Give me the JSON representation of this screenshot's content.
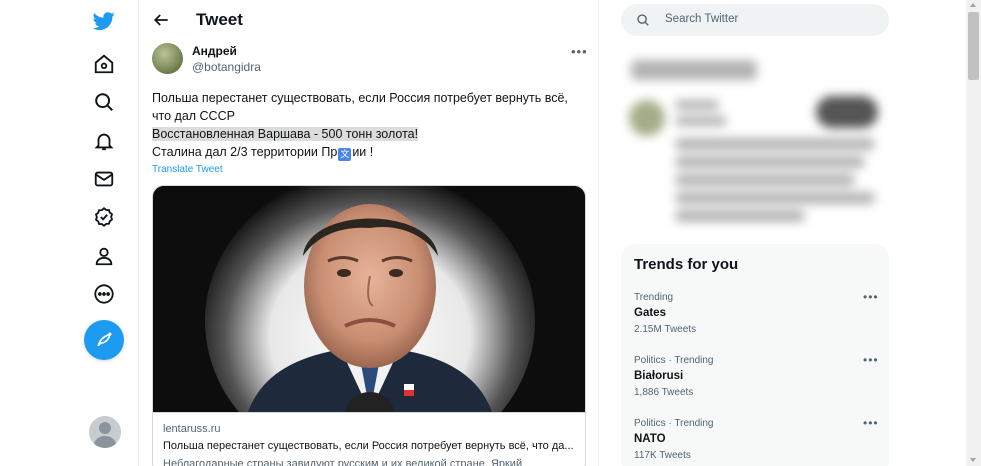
{
  "header": {
    "title": "Tweet"
  },
  "tweet": {
    "author_name": "Андрей",
    "author_handle": "@botangidra",
    "text_line1": "Польша перестанет существовать, если Россия потребует вернуть всё,",
    "text_line2": "что дал СССР",
    "text_line3": "Восстановленная Варшава - 500 тонн золота!",
    "text_line4_a": "Сталина дал 2/3 территории Пр",
    "text_line4_b": "ии !",
    "translate_label": "Translate Tweet",
    "card": {
      "domain": "lentaruss.ru",
      "title": "Польша перестанет существовать, если Россия потребует вернуть всё, что да...",
      "description": "Неблагодарные страны завидуют русским и их великой стране. Яркий"
    }
  },
  "search": {
    "placeholder": "Search Twitter"
  },
  "trends": {
    "title": "Trends for you",
    "items": [
      {
        "category": "Trending",
        "name": "Gates",
        "count": "2.15M Tweets"
      },
      {
        "category": "Politics · Trending",
        "name": "Białorusi",
        "count": "1,886 Tweets"
      },
      {
        "category": "Politics · Trending",
        "name": "NATO",
        "count": "117K Tweets"
      }
    ]
  },
  "colors": {
    "accent": "#1d9bf0",
    "text": "#0f1419",
    "muted": "#536471"
  },
  "icons": {
    "nav": [
      "twitter-logo-icon",
      "home-icon",
      "explore-icon",
      "notifications-icon",
      "messages-icon",
      "verified-icon",
      "profile-icon",
      "more-icon",
      "compose-icon"
    ]
  }
}
